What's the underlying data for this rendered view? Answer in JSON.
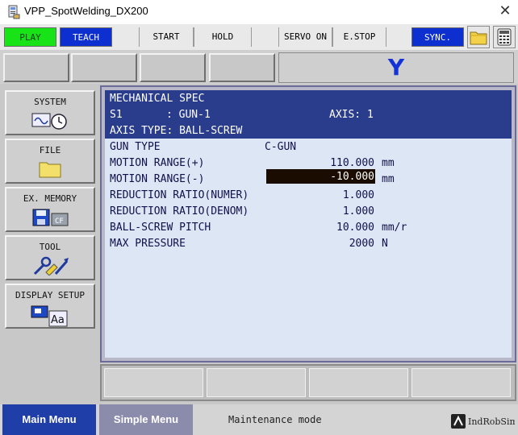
{
  "window": {
    "title": "VPP_SpotWelding_DX200",
    "close": "✕"
  },
  "topbar": {
    "play": "PLAY",
    "teach": "TEACH",
    "start": "START",
    "hold": "HOLD",
    "servo_on": "SERVO ON",
    "estop": "E.STOP",
    "sync": "SYNC.",
    "play_color": "#17e317",
    "teach_color": "#0d2fd0"
  },
  "coord_mode": "Y",
  "menu": [
    {
      "label": "SYSTEM",
      "icon": "system-icon"
    },
    {
      "label": "FILE",
      "icon": "folder-icon"
    },
    {
      "label": "EX. MEMORY",
      "icon": "memory-icon"
    },
    {
      "label": "TOOL",
      "icon": "tool-icon"
    },
    {
      "label": "DISPLAY SETUP",
      "icon": "display-setup-icon"
    }
  ],
  "panel": {
    "title": "MECHANICAL SPEC",
    "s_label": "S1",
    "s_value": ": GUN-1",
    "axis": "AXIS: 1",
    "axis_type": "AXIS TYPE: BALL-SCREW",
    "rows": [
      {
        "label": "GUN TYPE",
        "value": "C-GUN",
        "unit": ""
      },
      {
        "label": "MOTION RANGE(+)",
        "value": "110.000",
        "unit": "mm"
      },
      {
        "label": "MOTION RANGE(-)",
        "value": "-10.000",
        "unit": "mm",
        "selected": true
      },
      {
        "label": "REDUCTION RATIO(NUMER)",
        "value": "1.000",
        "unit": ""
      },
      {
        "label": "REDUCTION RATIO(DENOM)",
        "value": "1.000",
        "unit": ""
      },
      {
        "label": "BALL-SCREW PITCH",
        "value": "10.000",
        "unit": "mm/r"
      },
      {
        "label": "MAX PRESSURE",
        "value": "2000",
        "unit": "N"
      }
    ]
  },
  "bottom": {
    "main_menu": "Main Menu",
    "simple_menu": "Simple Menu",
    "status": "Maintenance mode",
    "logo_text": "IndRobSim"
  }
}
